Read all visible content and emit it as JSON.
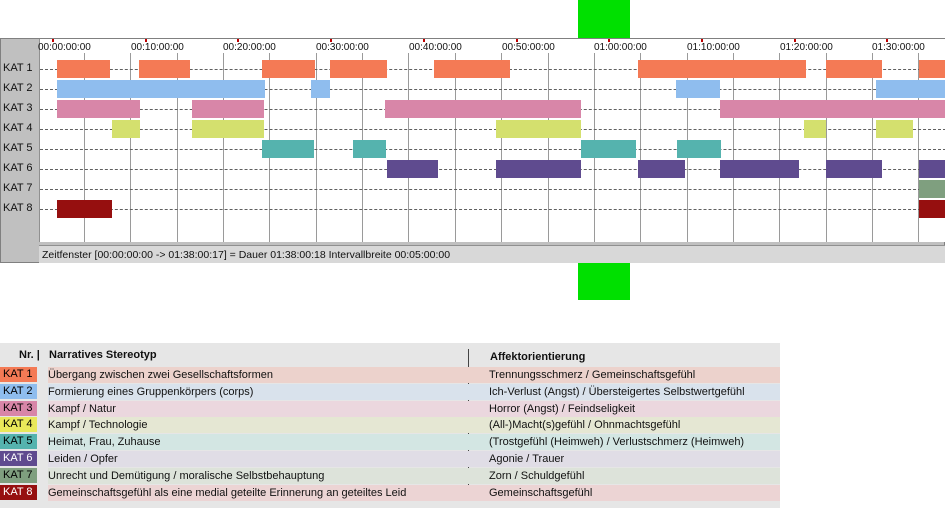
{
  "timeline": {
    "categories": [
      "KAT 1",
      "KAT 2",
      "KAT 3",
      "KAT 4",
      "KAT 5",
      "KAT 6",
      "KAT 7",
      "KAT 8"
    ],
    "time_labels": [
      "00:00:00:00",
      "00:10:00:00",
      "00:20:00:00",
      "00:30:00:00",
      "00:40:00:00",
      "00:50:00:00",
      "01:00:00:00",
      "01:10:00:00",
      "01:20:00:00",
      "01:30:00:00"
    ],
    "status_text": "Zeitfenster [00:00:00:00 -> 01:38:00:17] = Dauer 01:38:00:18    Intervallbreite 00:05:00:00",
    "total_minutes": 98,
    "interval_minutes": 5,
    "segments": [
      [
        [
          1.8,
          7.5
        ],
        [
          10.7,
          16.2
        ],
        [
          23.9,
          29.6
        ],
        [
          31.3,
          37.4
        ],
        [
          42.5,
          50.7
        ],
        [
          64.5,
          82.6
        ],
        [
          84.8,
          90.8
        ],
        [
          94.8,
          98
        ]
      ],
      [
        [
          1.8,
          24.2
        ],
        [
          29.2,
          31.2
        ],
        [
          68.6,
          73.4
        ],
        [
          90.2,
          98
        ]
      ],
      [
        [
          1.8,
          10.8
        ],
        [
          16.4,
          24.2
        ],
        [
          37.2,
          58.3
        ],
        [
          73.4,
          98
        ]
      ],
      [
        [
          7.8,
          10.8
        ],
        [
          16.4,
          24.2
        ],
        [
          49.2,
          58.4
        ],
        [
          82.4,
          84.8
        ],
        [
          90.2,
          94.2
        ]
      ],
      [
        [
          23.9,
          29.5
        ],
        [
          33.8,
          37.4
        ],
        [
          58.4,
          64.3
        ],
        [
          68.7,
          73.4
        ]
      ],
      [
        [
          37.4,
          42.9
        ],
        [
          49.2,
          58.4
        ],
        [
          64.5,
          69.6
        ],
        [
          73.4,
          81.9
        ],
        [
          84.8,
          90.8
        ],
        [
          94.8,
          98
        ]
      ],
      [
        [
          94.8,
          98
        ]
      ],
      [
        [
          1.8,
          7.7
        ],
        [
          94.8,
          98
        ]
      ]
    ]
  },
  "legend": {
    "col_nr": "Nr. |",
    "col_stereotyp": "Narratives Stereotyp",
    "col_affekt": "Affektorientierung",
    "rows": [
      {
        "code": "KAT 1",
        "stereotyp": "Übergang zwischen zwei Gesellschaftsformen",
        "affekt": "Trennungsschmerz / Gemeinschaftsgefühl"
      },
      {
        "code": "KAT 2",
        "stereotyp": "Formierung eines Gruppenkörpers (corps)",
        "affekt": "Ich-Verlust (Angst) / Übersteigertes Selbstwertgefühl"
      },
      {
        "code": "KAT 3",
        "stereotyp": "Kampf / Natur",
        "affekt": "Horror (Angst) / Feindseligkeit"
      },
      {
        "code": "KAT 4",
        "stereotyp": "Kampf / Technologie",
        "affekt": "(All-)Macht(s)gefühl / Ohnmachtsgefühl"
      },
      {
        "code": "KAT 5",
        "stereotyp": "Heimat, Frau, Zuhause",
        "affekt": "(Trostgefühl (Heimweh) / Verlustschmerz (Heimweh)"
      },
      {
        "code": "KAT 6",
        "stereotyp": "Leiden / Opfer",
        "affekt": "Agonie / Trauer"
      },
      {
        "code": "KAT 7",
        "stereotyp": "Unrecht und Demütigung / moralische Selbstbehauptung",
        "affekt": "Zorn / Schuldgefühl"
      },
      {
        "code": "KAT 8",
        "stereotyp": "Gemeinschaftsgefühl als eine medial geteilte Erinnerung an geteiltes Leid",
        "affekt": "Gemeinschaftsgefühl"
      }
    ]
  },
  "colors": {
    "categories": [
      "#f47a55",
      "#8fbdee",
      "#d886a8",
      "#d4e06e",
      "#55b3ae",
      "#5f4b8f",
      "#7f9f7f",
      "#960f0f"
    ],
    "legend_rows": [
      "#ecd2cc",
      "#d9e2ec",
      "#ebd7de",
      "#e5e7d3",
      "#d3e6e3",
      "#e0dde6",
      "#dde3da",
      "#ecd4d4"
    ],
    "legend_codes": [
      "#f47a55",
      "#8fbdee",
      "#d886a8",
      "#e9e85a",
      "#55b3ae",
      "#5f4b8f",
      "#7f9f7f",
      "#960f0f"
    ],
    "legend_code_text": [
      "#000000",
      "#000000",
      "#000000",
      "#000000",
      "#000000",
      "#ffffff",
      "#000000",
      "#ffffff"
    ],
    "green_marker": "#00e000"
  }
}
